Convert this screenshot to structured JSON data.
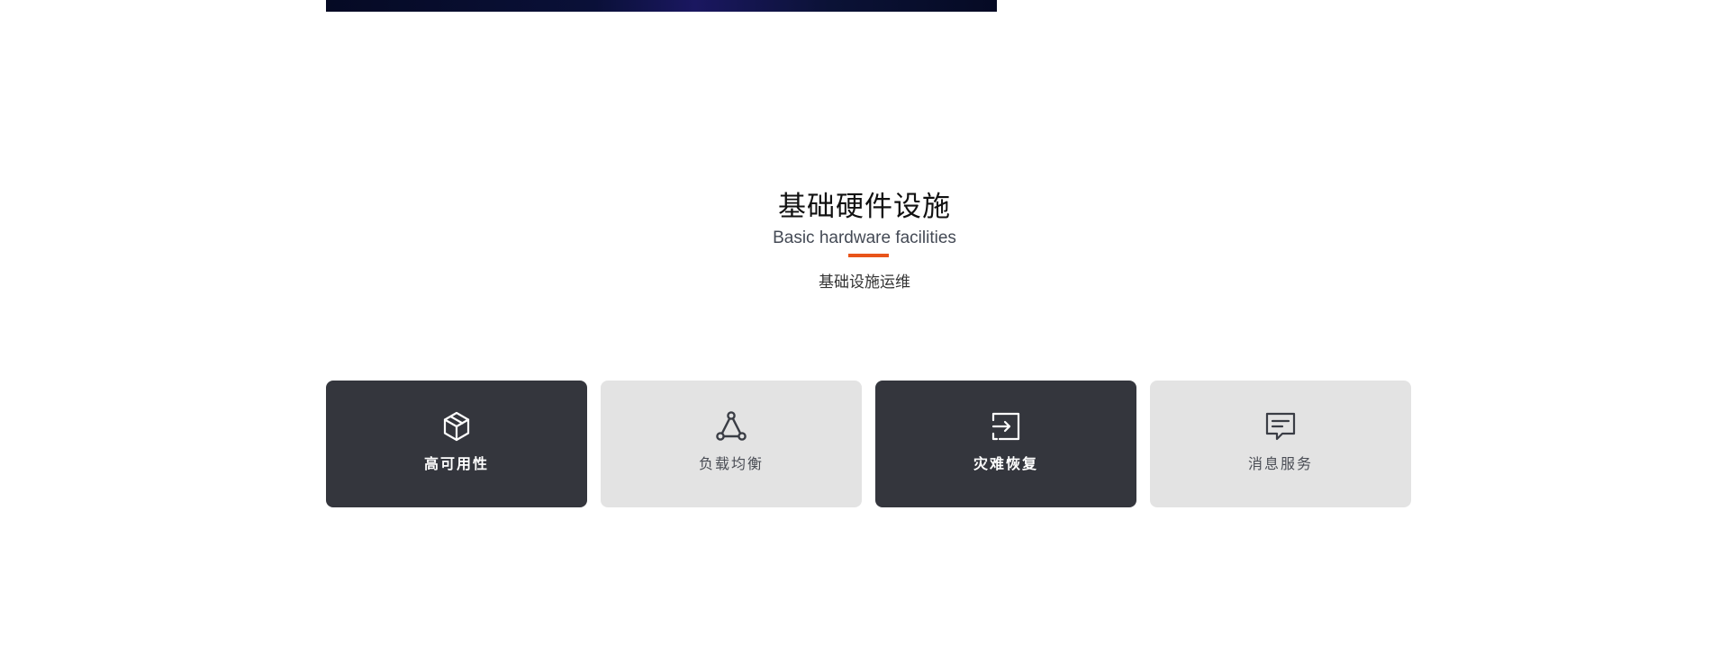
{
  "section": {
    "title": "基础硬件设施",
    "subtitle": "Basic hardware facilities",
    "description": "基础设施运维",
    "accent_color": "#e8541a"
  },
  "cards": [
    {
      "label": "高可用性",
      "icon": "cube-icon",
      "style": "dark"
    },
    {
      "label": "负载均衡",
      "icon": "network-nodes-icon",
      "style": "light"
    },
    {
      "label": "灾难恢复",
      "icon": "recovery-icon",
      "style": "dark"
    },
    {
      "label": "消息服务",
      "icon": "message-icon",
      "style": "light"
    }
  ],
  "colors": {
    "dark_card": "#34363d",
    "light_card": "#e3e3e3",
    "banner": "#0a1038"
  }
}
